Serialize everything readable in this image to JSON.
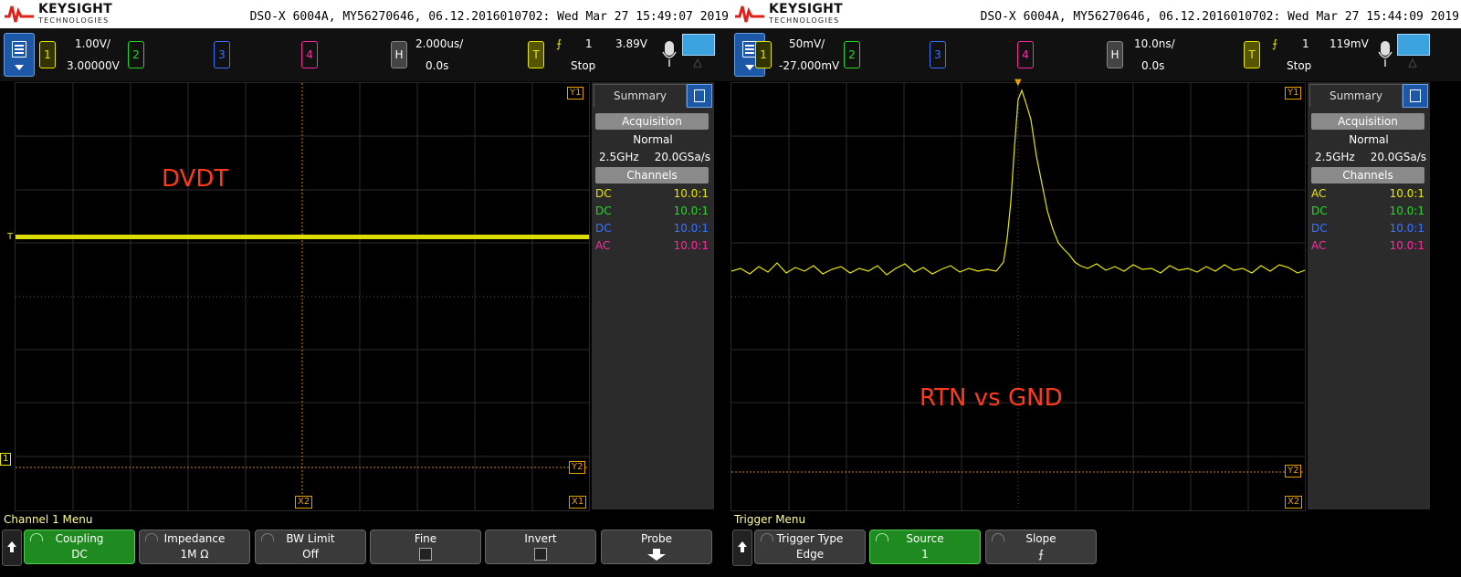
{
  "left": {
    "brand": {
      "name": "KEYSIGHT",
      "sub": "TECHNOLOGIES"
    },
    "info": "DSO-X 6004A, MY56270646, 06.12.2016010702: Wed Mar 27 15:49:07 2019",
    "channels": {
      "ch1": "1",
      "ch2": "2",
      "ch3": "3",
      "ch4": "4"
    },
    "ch1_scale": "1.00V/",
    "ch1_offset": "3.00000V",
    "horiz_badge": "H",
    "timebase": "2.000us/",
    "delay": "0.0s",
    "trig_badge": "T",
    "trig_source": "1",
    "trig_level": "3.89V",
    "run_state": "Stop",
    "annotation": "DVDT",
    "markers": {
      "y1": "Y1",
      "y2": "Y2",
      "x1": "X1",
      "x2": "X2",
      "t": "T",
      "ch1": "1"
    },
    "summary": {
      "tab": "Summary",
      "acq_header": "Acquisition",
      "acq_mode": "Normal",
      "bandwidth": "2.5GHz",
      "sample_rate": "20.0GSa/s",
      "channels_header": "Channels",
      "channel_rows": [
        {
          "coupling": "DC",
          "probe": "10.0:1",
          "color": "#e8e800"
        },
        {
          "coupling": "DC",
          "probe": "10.0:1",
          "color": "#27d827"
        },
        {
          "coupling": "DC",
          "probe": "10.0:1",
          "color": "#3a72ff"
        },
        {
          "coupling": "AC",
          "probe": "10.0:1",
          "color": "#ff2aa0"
        }
      ]
    },
    "menu_title": "Channel 1 Menu",
    "softkeys": [
      {
        "label": "Coupling",
        "value": "DC",
        "active": true
      },
      {
        "label": "Impedance",
        "value": "1M Ω",
        "active": false
      },
      {
        "label": "BW Limit",
        "value": "Off",
        "active": false
      },
      {
        "label": "Fine",
        "value": "",
        "active": false,
        "checkbox": true
      },
      {
        "label": "Invert",
        "value": "",
        "active": false,
        "checkbox": true
      },
      {
        "label": "Probe",
        "value": "",
        "active": false,
        "arrow": true
      }
    ]
  },
  "right": {
    "brand": {
      "name": "KEYSIGHT",
      "sub": "TECHNOLOGIES"
    },
    "info": "DSO-X 6004A, MY56270646, 06.12.2016010702: Wed Mar 27 15:44:09 2019",
    "channels": {
      "ch1": "1",
      "ch2": "2",
      "ch3": "3",
      "ch4": "4"
    },
    "ch1_scale": "50mV/",
    "ch1_offset": "-27.000mV",
    "horiz_badge": "H",
    "timebase": "10.0ns/",
    "delay": "0.0s",
    "trig_badge": "T",
    "trig_source": "1",
    "trig_level": "119mV",
    "run_state": "Stop",
    "annotation": "RTN vs GND",
    "markers": {
      "y1": "Y1",
      "y2": "Y2",
      "x2": "X2",
      "t": "T",
      "ch1": "1"
    },
    "summary": {
      "tab": "Summary",
      "acq_header": "Acquisition",
      "acq_mode": "Normal",
      "bandwidth": "2.5GHz",
      "sample_rate": "20.0GSa/s",
      "channels_header": "Channels",
      "channel_rows": [
        {
          "coupling": "AC",
          "probe": "10.0:1",
          "color": "#e8e800"
        },
        {
          "coupling": "DC",
          "probe": "10.0:1",
          "color": "#27d827"
        },
        {
          "coupling": "DC",
          "probe": "10.0:1",
          "color": "#3a72ff"
        },
        {
          "coupling": "AC",
          "probe": "10.0:1",
          "color": "#ff2aa0"
        }
      ]
    },
    "menu_title": "Trigger Menu",
    "softkeys": [
      {
        "label": "Trigger Type",
        "value": "Edge",
        "active": false
      },
      {
        "label": "Source",
        "value": "1",
        "active": true
      },
      {
        "label": "Slope",
        "value": "⨍",
        "active": false
      }
    ]
  },
  "colors": {
    "ch1": "#e8e800",
    "ch2": "#27d827",
    "ch3": "#3a72ff",
    "ch4": "#ff2aa0",
    "marker": "#e8a000",
    "annotation": "#ff3a1a"
  }
}
